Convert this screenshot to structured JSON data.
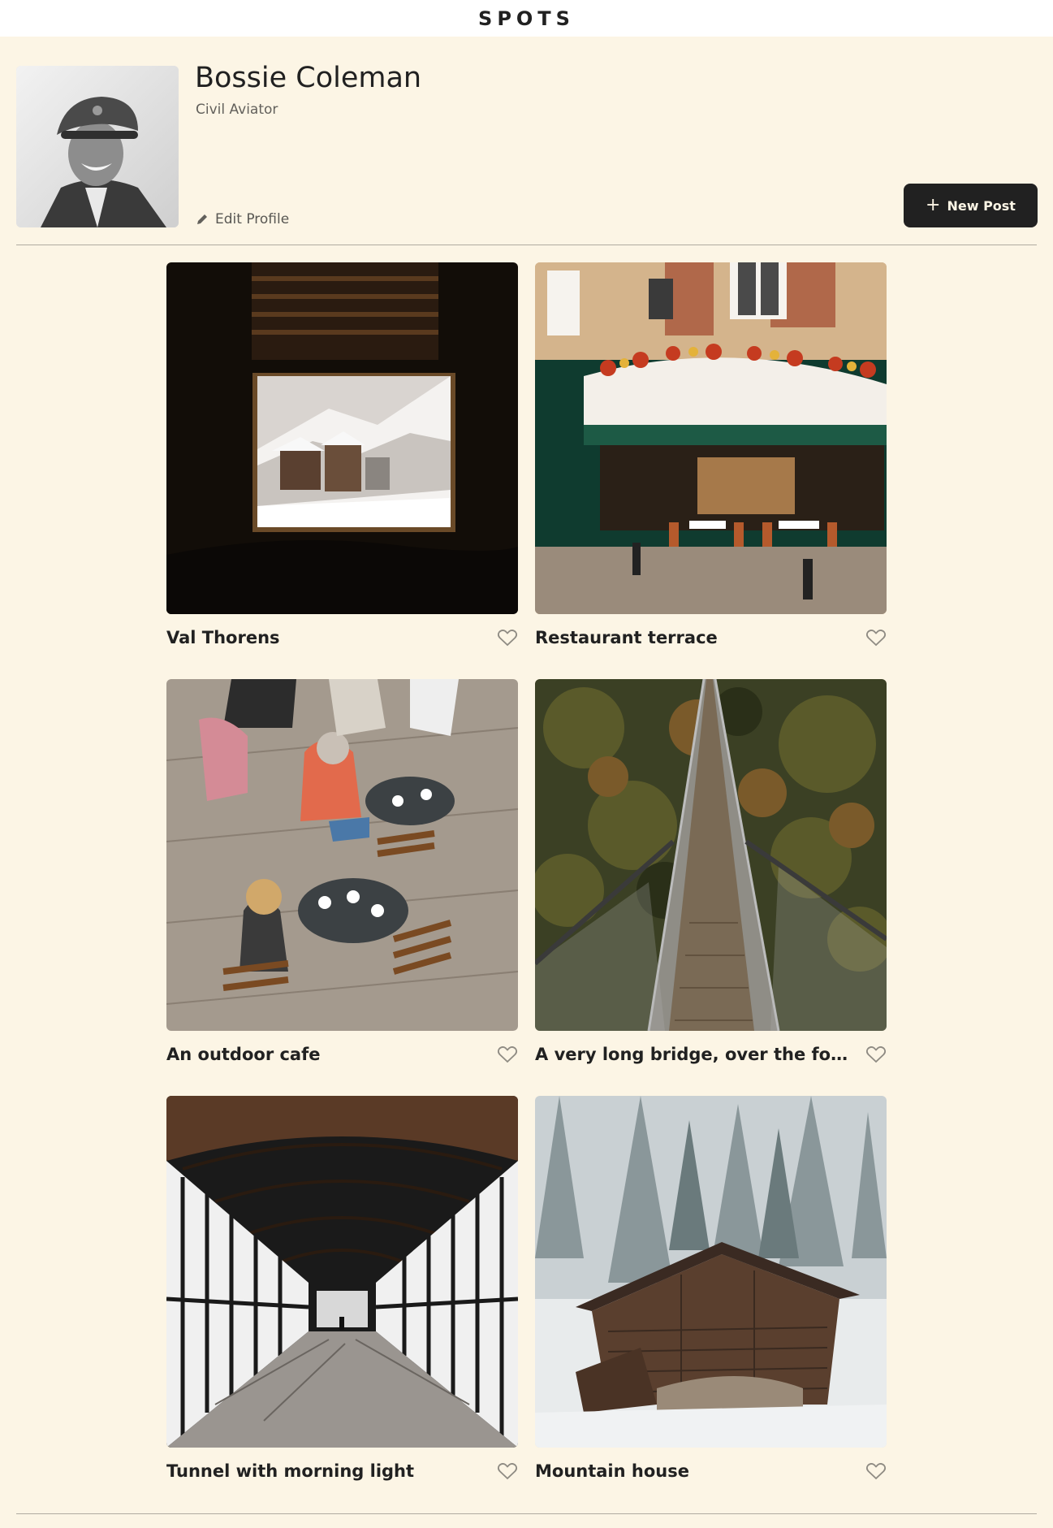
{
  "header": {
    "logo": "SPOTS"
  },
  "profile": {
    "name": "Bossie Coleman",
    "description": "Civil Aviator",
    "edit_label": "Edit Profile",
    "new_post_label": "New Post"
  },
  "cards": [
    {
      "title": "Val Thorens"
    },
    {
      "title": "Restaurant terrace"
    },
    {
      "title": "An outdoor cafe"
    },
    {
      "title": "A very long bridge, over the forest"
    },
    {
      "title": "Tunnel with morning light"
    },
    {
      "title": "Mountain house"
    }
  ],
  "icons": {
    "edit": "pencil-icon",
    "new_post": "plus-icon",
    "like": "heart-outline-icon"
  },
  "colors": {
    "background": "#FCF5E5",
    "text": "#212121",
    "button": "#212121",
    "header": "#FFFFFF"
  }
}
